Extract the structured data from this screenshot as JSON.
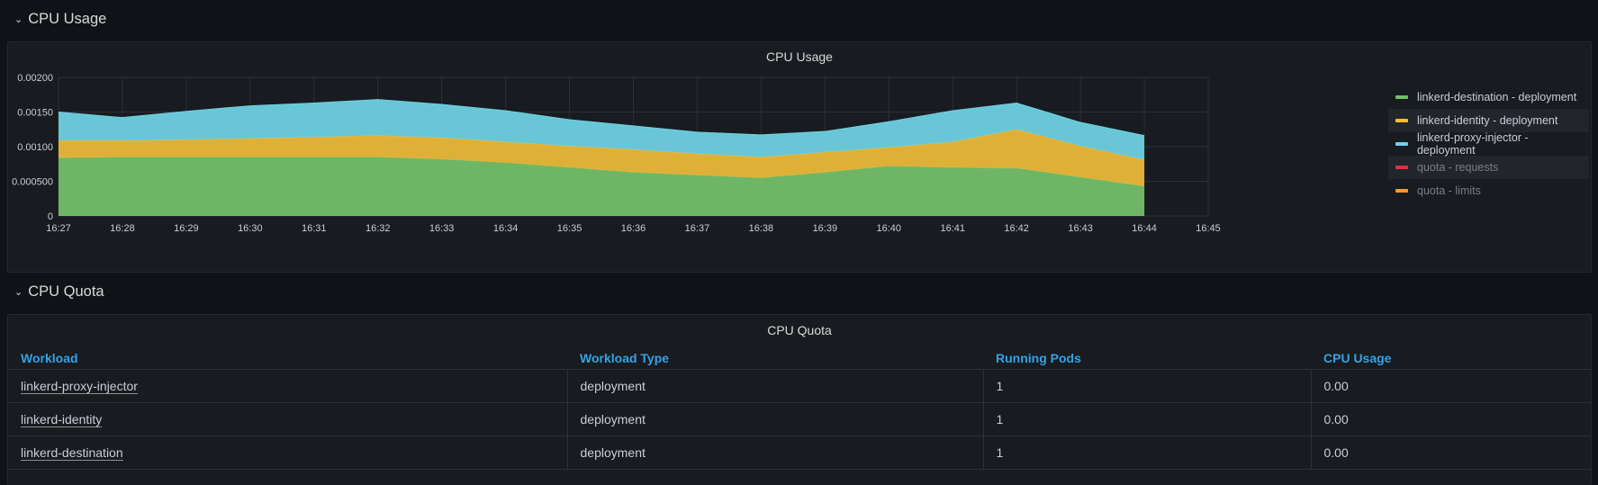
{
  "rows": [
    {
      "title": "CPU Usage"
    },
    {
      "title": "CPU Quota"
    }
  ],
  "cpu_usage_panel": {
    "title": "CPU Usage",
    "legend": [
      {
        "label": "linkerd-destination - deployment",
        "color": "#73bf69"
      },
      {
        "label": "linkerd-identity - deployment",
        "color": "#f2c02f"
      },
      {
        "label": "linkerd-proxy-injector - deployment",
        "color": "#73d0ea"
      },
      {
        "label": "quota - requests",
        "color": "#e02f44"
      },
      {
        "label": "quota - limits",
        "color": "#ff9830"
      }
    ]
  },
  "chart_data": {
    "type": "area",
    "stacked": true,
    "title": "CPU Usage",
    "x": [
      "16:27",
      "16:28",
      "16:29",
      "16:30",
      "16:31",
      "16:32",
      "16:33",
      "16:34",
      "16:35",
      "16:36",
      "16:37",
      "16:38",
      "16:39",
      "16:40",
      "16:41",
      "16:42",
      "16:43",
      "16:44"
    ],
    "x_ticks": [
      "16:27",
      "16:28",
      "16:29",
      "16:30",
      "16:31",
      "16:32",
      "16:33",
      "16:34",
      "16:35",
      "16:36",
      "16:37",
      "16:38",
      "16:39",
      "16:40",
      "16:41",
      "16:42",
      "16:43",
      "16:44",
      "16:45"
    ],
    "y_ticks": [
      "0",
      "0.000500",
      "0.00100",
      "0.00150",
      "0.00200"
    ],
    "ylim": [
      0,
      0.002
    ],
    "grid": true,
    "legend_position": "right",
    "series": [
      {
        "name": "linkerd-destination - deployment",
        "color": "#73bf69",
        "values": [
          0.00084,
          0.00085,
          0.00085,
          0.00085,
          0.00085,
          0.00085,
          0.00082,
          0.00077,
          0.0007,
          0.00063,
          0.00059,
          0.00055,
          0.00063,
          0.00072,
          0.0007,
          0.00069,
          0.00056,
          0.00043
        ]
      },
      {
        "name": "linkerd-identity - deployment",
        "color": "#eab839",
        "values": [
          0.00025,
          0.00024,
          0.00025,
          0.00027,
          0.00029,
          0.00031,
          0.00031,
          0.0003,
          0.00031,
          0.00033,
          0.00031,
          0.0003,
          0.00029,
          0.00027,
          0.00037,
          0.00056,
          0.00045,
          0.00038
        ]
      },
      {
        "name": "linkerd-proxy-injector - deployment",
        "color": "#6ed0e0",
        "values": [
          0.00041,
          0.00033,
          0.00041,
          0.00047,
          0.00049,
          0.00052,
          0.00048,
          0.00045,
          0.00038,
          0.00034,
          0.00031,
          0.00032,
          0.0003,
          0.00037,
          0.00045,
          0.00038,
          0.00034,
          0.00035
        ]
      }
    ]
  },
  "cpu_quota_panel": {
    "title": "CPU Quota",
    "columns": [
      "Workload",
      "Workload Type",
      "Running Pods",
      "CPU Usage"
    ],
    "rows": [
      [
        "linkerd-proxy-injector",
        "deployment",
        "1",
        "0.00"
      ],
      [
        "linkerd-identity",
        "deployment",
        "1",
        "0.00"
      ],
      [
        "linkerd-destination",
        "deployment",
        "1",
        "0.00"
      ]
    ]
  }
}
